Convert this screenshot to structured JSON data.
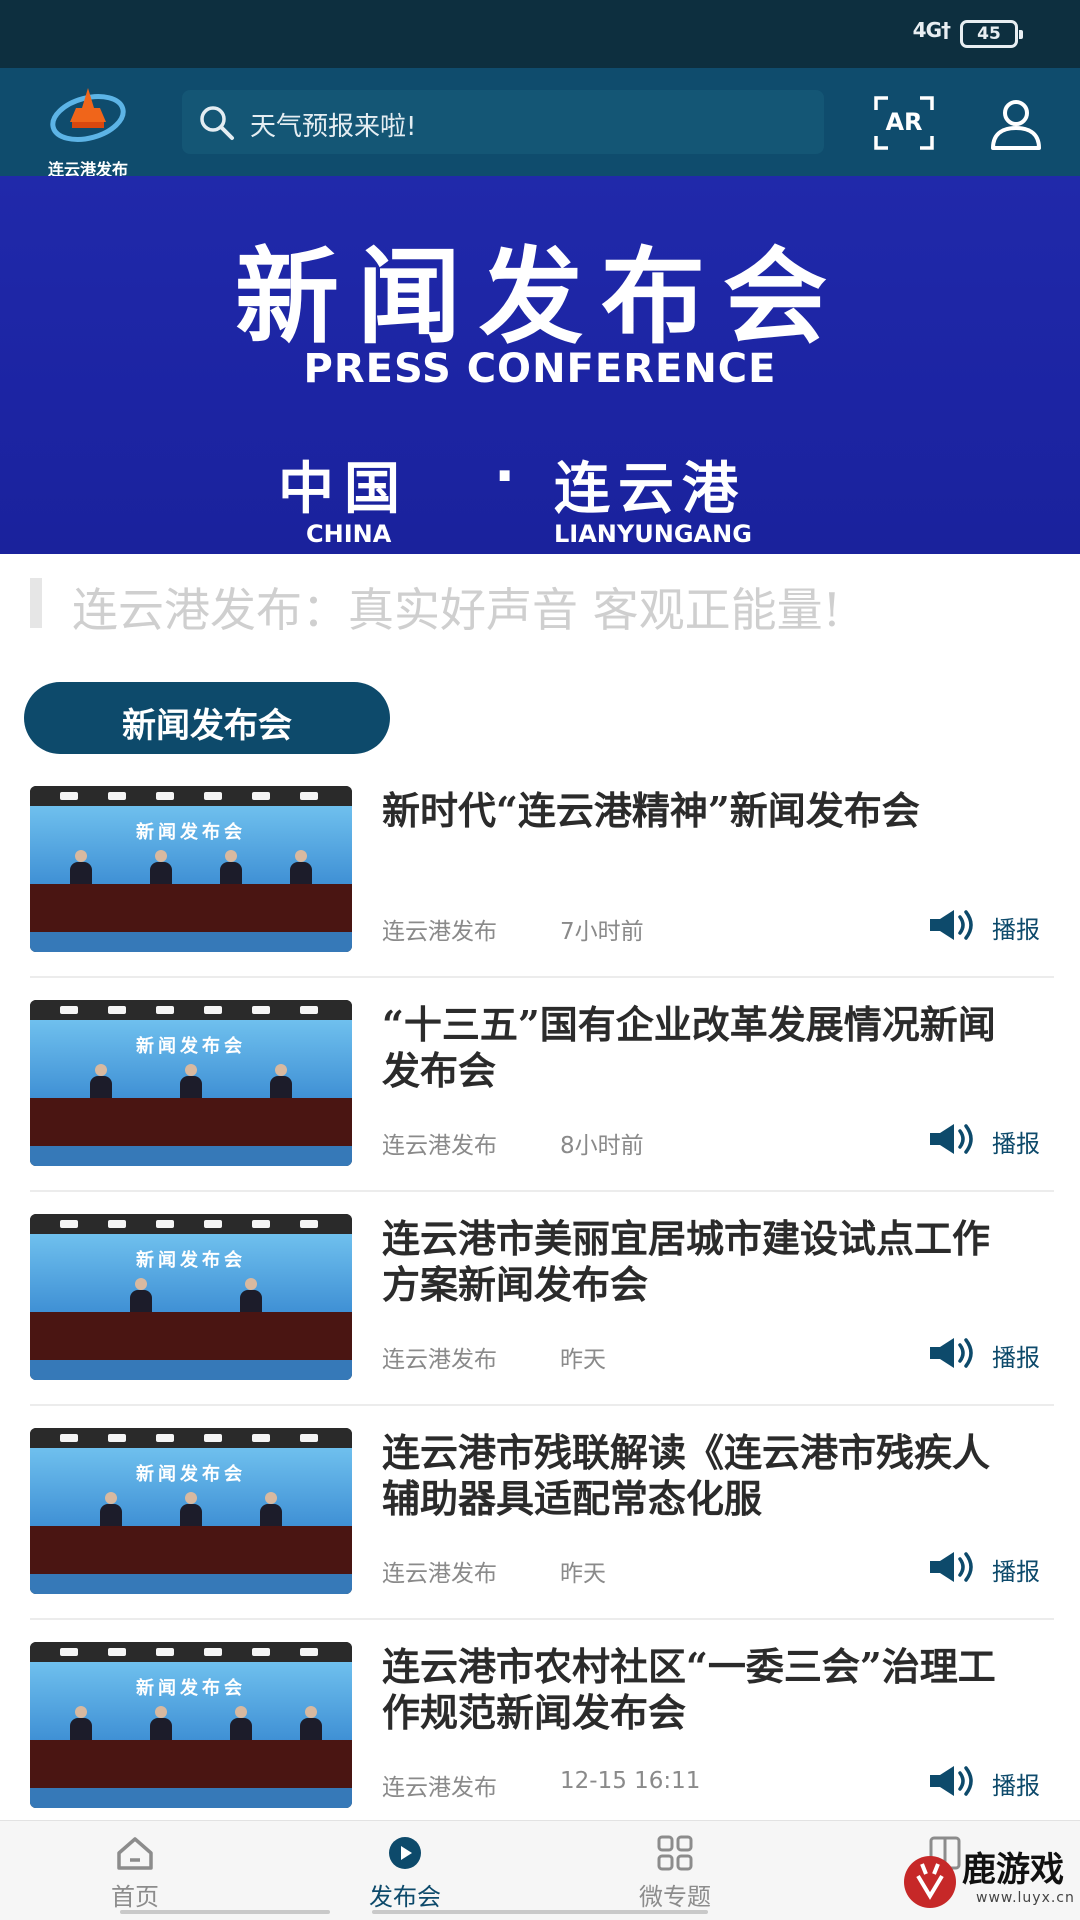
{
  "status_bar": {
    "network": "4G†",
    "battery": "45"
  },
  "header": {
    "logo_text": "连云港发布",
    "search_placeholder": "天气预报来啦!",
    "ar_label": "AR"
  },
  "banner": {
    "title": "新闻发布会",
    "subtitle": "PRESS CONFERENCE",
    "location_cn_left": "中国",
    "location_cn_dot": "·",
    "location_cn_right": "连云港",
    "location_en_left": "CHINA",
    "location_en_right": "LIANYUNGANG"
  },
  "slogan": "连云港发布：真实好声音 客观正能量!",
  "section": {
    "title": "新闻发布会"
  },
  "news": [
    {
      "title": "新时代“连云港精神”新闻发布会",
      "source": "连云港发布",
      "time": "7小时前",
      "broadcast": "播报"
    },
    {
      "title": "“十三五”国有企业改革发展情况新闻发布会",
      "source": "连云港发布",
      "time": "8小时前",
      "broadcast": "播报"
    },
    {
      "title": "连云港市美丽宜居城市建设试点工作方案新闻发布会",
      "source": "连云港发布",
      "time": "昨天",
      "broadcast": "播报"
    },
    {
      "title": "连云港市残联解读《连云港市残疾人辅助器具适配常态化服",
      "source": "连云港发布",
      "time": "昨天",
      "broadcast": "播报"
    },
    {
      "title": "连云港市农村社区“一委三会”治理工作规范新闻发布会",
      "source": "连云港发布",
      "time": "12-15 16:11",
      "broadcast": "播报"
    }
  ],
  "thumb_caption": "新闻发布会",
  "bottom_nav": [
    {
      "label": "首页",
      "icon": "home-icon"
    },
    {
      "label": "发布会",
      "icon": "play-icon",
      "active": true
    },
    {
      "label": "微专题",
      "icon": "grid-icon"
    },
    {
      "label": "",
      "icon": "book-icon"
    }
  ],
  "watermark": {
    "text": "鹿游戏",
    "url": "www.luyx.cn"
  },
  "colors": {
    "header": "#0f4c6d",
    "banner": "#1f27a8",
    "accent": "#0d4a6b",
    "status_bar": "#0d2f3f"
  }
}
